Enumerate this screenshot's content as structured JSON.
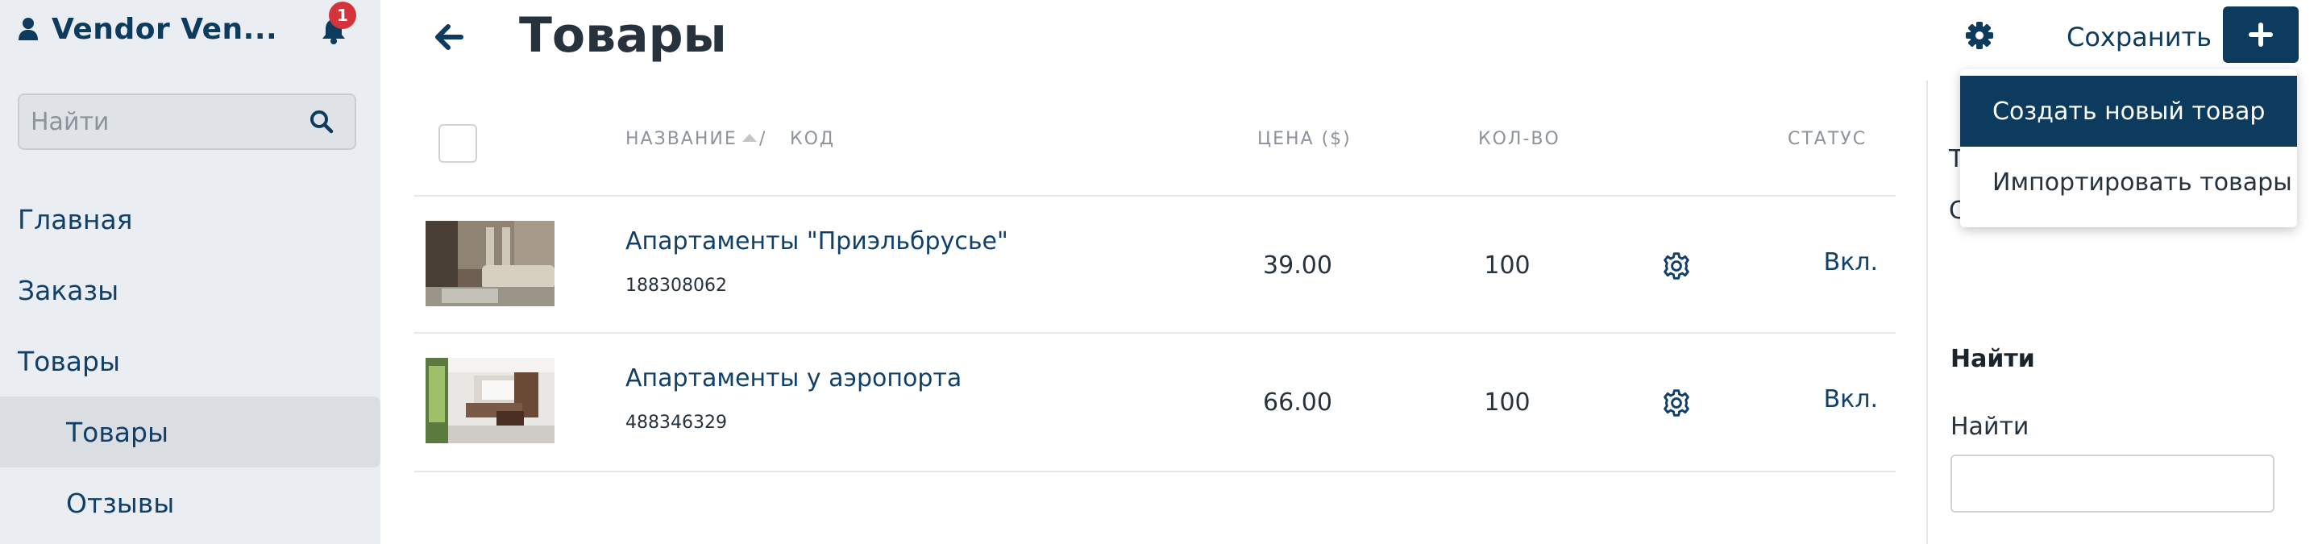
{
  "sidebar": {
    "vendor_name": "Vendor Ven...",
    "notifications_count": "1",
    "search_placeholder": "Найти",
    "items": [
      {
        "label": "Главная"
      },
      {
        "label": "Заказы"
      },
      {
        "label": "Товары"
      },
      {
        "label": "Товары"
      },
      {
        "label": "Отзывы"
      }
    ]
  },
  "header": {
    "title": "Товары",
    "save_label": "Сохранить"
  },
  "add_menu": {
    "items": [
      {
        "label": "Создать новый товар"
      },
      {
        "label": "Импортировать товары"
      }
    ]
  },
  "table": {
    "columns": {
      "name": "НАЗВАНИЕ",
      "separator": "/",
      "code": "КОД",
      "price": "ЦЕНА ($)",
      "qty": "КОЛ-ВО",
      "status": "СТАТУС"
    },
    "rows": [
      {
        "name": "Апартаменты \"Приэльбрусье\"",
        "code": "188308062",
        "price": "39.00",
        "qty": "100",
        "status": "Вкл."
      },
      {
        "name": "Апартаменты у аэропорта",
        "code": "488346329",
        "price": "66.00",
        "qty": "100",
        "status": "Вкл."
      }
    ]
  },
  "right_panel": {
    "clipped_1": "Т",
    "clipped_2": "С",
    "heading": "Найти",
    "label": "Найти",
    "input_value": ""
  },
  "colors": {
    "brand": "#0d3b5e",
    "link": "#10406a",
    "sidebar_bg": "#eaedf1",
    "badge": "#d4333c"
  }
}
